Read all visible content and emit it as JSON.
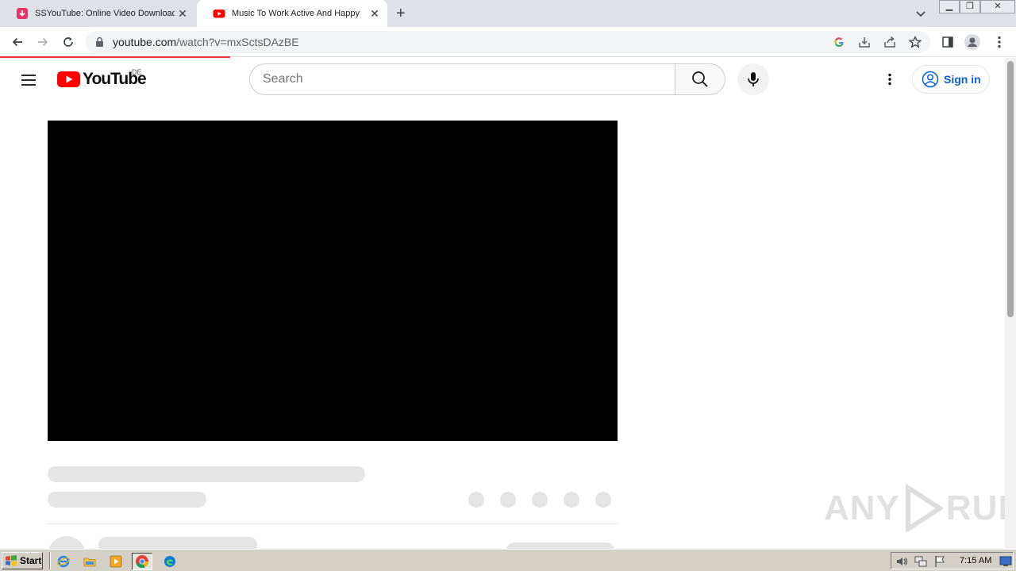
{
  "browser": {
    "tabs": [
      {
        "title": "SSYouTube: Online Video Downloade",
        "active": false
      },
      {
        "title": "Music To Work Active And Happy",
        "active": true
      }
    ],
    "url_host": "youtube.com",
    "url_path": "/watch?v=mxSctsDAzBE"
  },
  "youtube": {
    "logo_text": "YouTube",
    "country_code": "DE",
    "search_placeholder": "Search",
    "sign_in_label": "Sign in"
  },
  "watermark": {
    "left": "ANY",
    "right": "RUN"
  },
  "taskbar": {
    "start_label": "Start",
    "clock": "7:15 AM"
  },
  "colors": {
    "youtube_red": "#ff0000",
    "link_blue": "#065fd4",
    "skeleton": "#e5e5e5",
    "loading_bar": "#e53935"
  }
}
